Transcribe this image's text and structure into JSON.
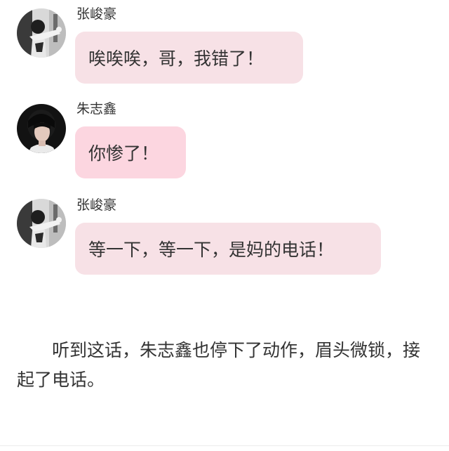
{
  "messages": [
    {
      "sender": "张峻豪",
      "avatar_icon": "avatar-zhang-junhao-icon",
      "text": "唉唉唉，哥，我错了！",
      "bubble_color": "#f7e1e6"
    },
    {
      "sender": "朱志鑫",
      "avatar_icon": "avatar-zhu-zhixin-icon",
      "text": "你惨了！",
      "bubble_color": "#fcd6e0"
    },
    {
      "sender": "张峻豪",
      "avatar_icon": "avatar-zhang-junhao-icon",
      "text": "等一下，等一下，是妈的电话！",
      "bubble_color": "#f7e1e6"
    }
  ],
  "narration": "听到这话，朱志鑫也停下了动作，眉头微锁，接起了电话。"
}
